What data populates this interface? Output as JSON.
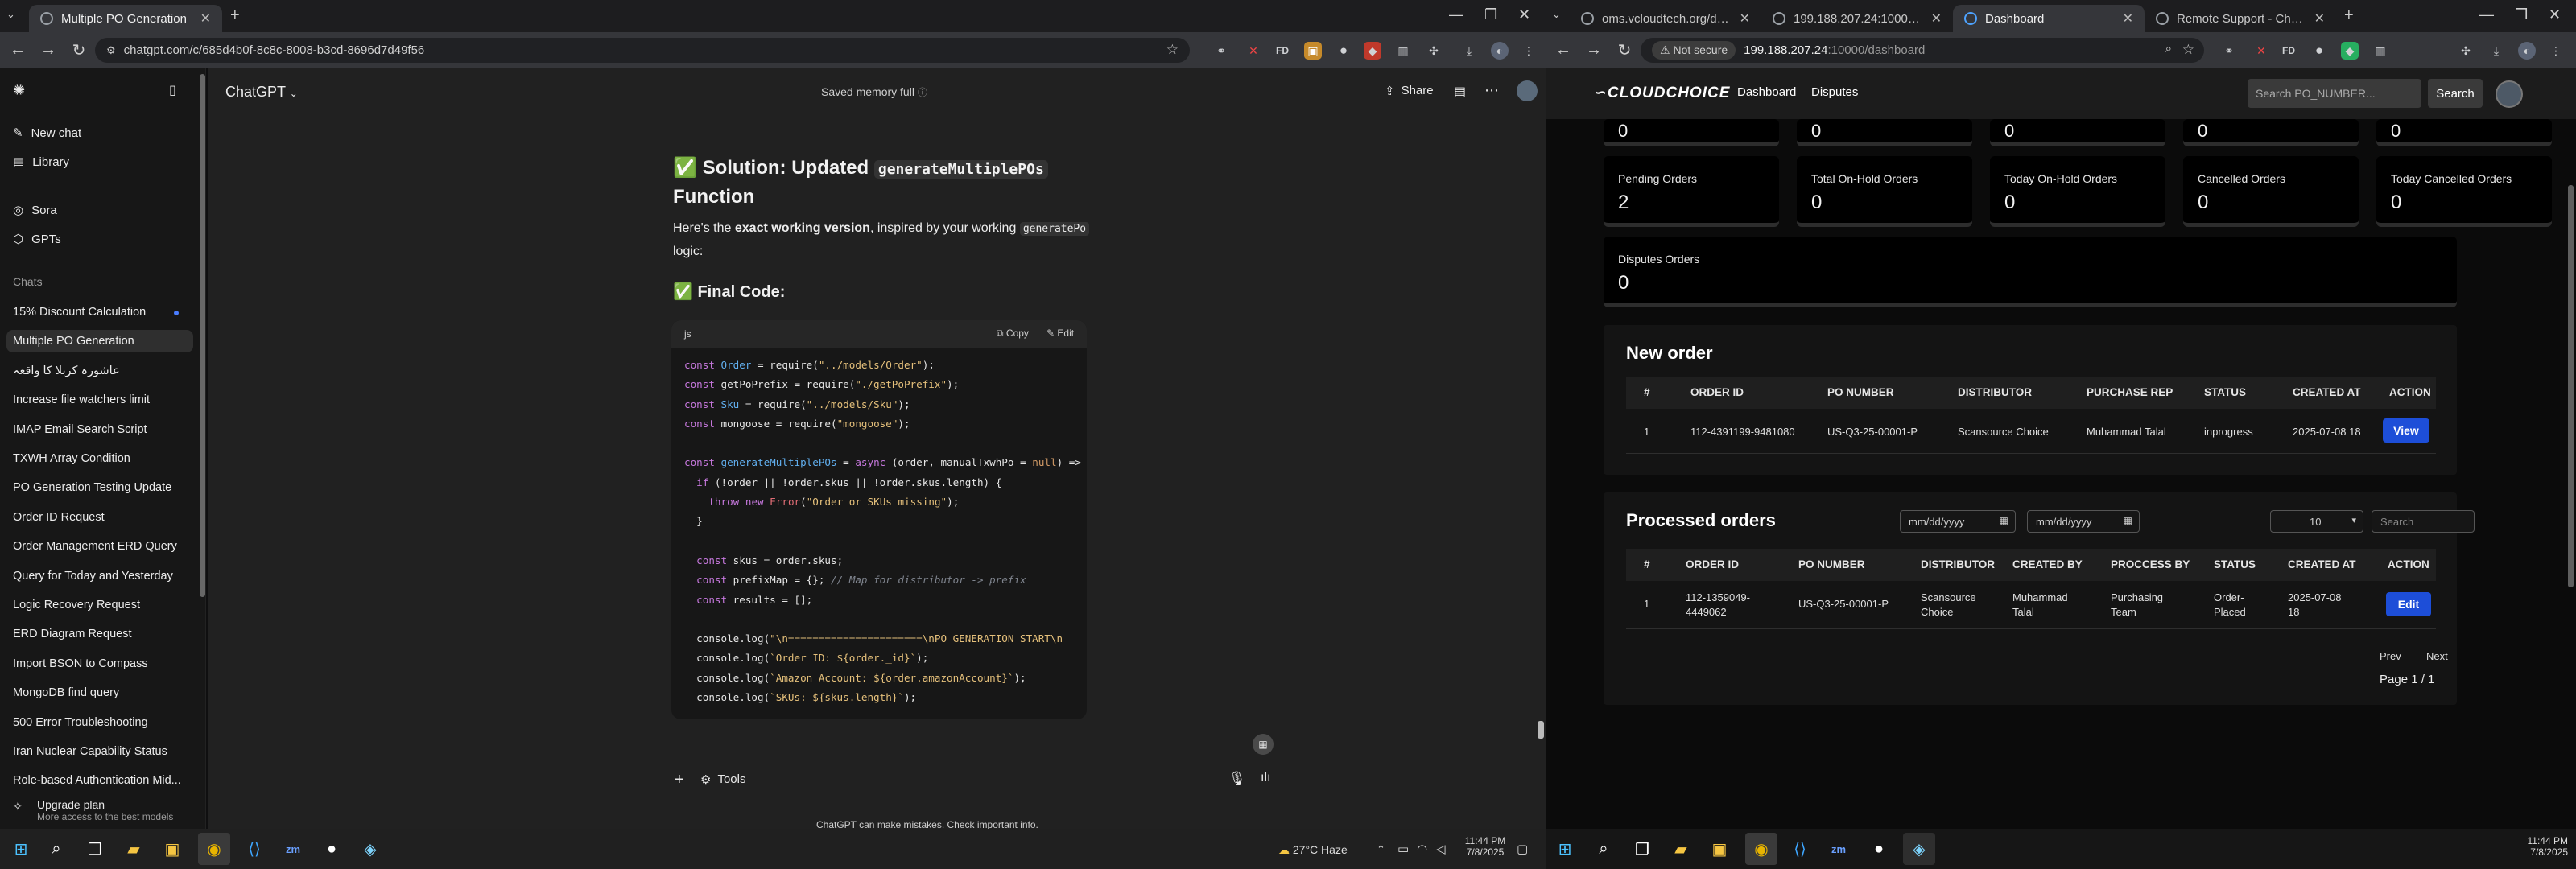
{
  "left_browser": {
    "tabs": [
      {
        "title": "Multiple PO Generation",
        "active": true
      }
    ],
    "url": "chatgpt.com/c/685d4b0f-8c8c-8008-b3cd-8696d7d49f56"
  },
  "chatgpt": {
    "model_label": "ChatGPT",
    "memory_status": "Saved memory full",
    "share_label": "Share",
    "side_items": {
      "new_chat": "New chat",
      "library": "Library",
      "sora": "Sora",
      "gpts": "GPTs"
    },
    "chats_heading": "Chats",
    "chats": [
      "15% Discount Calculation",
      "Multiple PO Generation",
      "عاشورہ کربلا کا واقعہ",
      "Increase file watchers limit",
      "IMAP Email Search Script",
      "TXWH Array Condition",
      "PO Generation Testing Update",
      "Order ID Request",
      "Order Management ERD Query",
      "Query for Today and Yesterday",
      "Logic Recovery Request",
      "ERD Diagram Request",
      "Import BSON to Compass",
      "MongoDB find query",
      "500 Error Troubleshooting",
      "Iran Nuclear Capability Status",
      "Role-based Authentication Mid..."
    ],
    "upgrade_title": "Upgrade plan",
    "upgrade_sub": "More access to the best models",
    "heading_emoji": "✅",
    "heading_prefix": "Solution: Updated",
    "heading_code": "generateMultiplePOs",
    "heading_suffix": "Function",
    "intro_a": "Here's the",
    "intro_bold": "exact working version",
    "intro_b": ", inspired by your working",
    "intro_code": "generatePo",
    "intro_c": "logic:",
    "final_code_heading": "Final Code:",
    "code_lang": "js",
    "copy_label": "Copy",
    "edit_label": "Edit",
    "tools_label": "Tools",
    "disclaimer": "ChatGPT can make mistakes. Check important info."
  },
  "right_browser": {
    "tabs": [
      {
        "title": "oms.vcloudtech.org/dashboard"
      },
      {
        "title": "199.188.207.24:10000/dashboa..."
      },
      {
        "title": "Dashboard",
        "active": true
      },
      {
        "title": "Remote Support - Chrome Rem..."
      }
    ],
    "security_label": "Not secure",
    "url_host": "199.188.207.24",
    "url_rest": ":10000/dashboard"
  },
  "dashboard": {
    "brand": "CLOUDCHOICE",
    "nav": [
      "Dashboard",
      "Disputes"
    ],
    "search_placeholder": "Search PO_NUMBER...",
    "search_button": "Search",
    "top_values": [
      "0",
      "0",
      "0",
      "0",
      "0"
    ],
    "cards": [
      {
        "label": "Pending Orders",
        "value": "2"
      },
      {
        "label": "Total On-Hold Orders",
        "value": "0"
      },
      {
        "label": "Today On-Hold Orders",
        "value": "0"
      },
      {
        "label": "Cancelled Orders",
        "value": "0"
      },
      {
        "label": "Today Cancelled Orders",
        "value": "0"
      },
      {
        "label": "Disputes Orders",
        "value": "0"
      }
    ],
    "new_order": {
      "title": "New order",
      "headers": [
        "#",
        "ORDER ID",
        "PO NUMBER",
        "DISTRIBUTOR",
        "PURCHASE REP",
        "STATUS",
        "CREATED AT",
        "ACTION"
      ],
      "row": [
        "1",
        "112-4391199-9481080",
        "US-Q3-25-00001-P",
        "Scansource Choice",
        "Muhammad Talal",
        "inprogress",
        "2025-07-08 18"
      ],
      "action": "View"
    },
    "processed": {
      "title": "Processed orders",
      "date_placeholder": "mm/dd/yyyy",
      "page_size": "10",
      "search_placeholder": "Search",
      "headers": [
        "#",
        "ORDER ID",
        "PO NUMBER",
        "DISTRIBUTOR",
        "CREATED BY",
        "PROCCESS BY",
        "STATUS",
        "CREATED AT",
        "ACTION"
      ],
      "row": [
        "1",
        "112-1359049-\n4449062",
        "US-Q3-25-00001-P",
        "Scansource\nChoice",
        "Muhammad\nTalal",
        "Purchasing\nTeam",
        "Order-\nPlaced",
        "2025-07-08\n18"
      ],
      "action": "Edit",
      "prev": "Prev",
      "next": "Next",
      "page_info": "Page 1 / 1"
    }
  },
  "taskbar_left": {
    "weather": "27°C  Haze",
    "time": "11:44 PM",
    "date": "7/8/2025"
  },
  "taskbar_right": {
    "time": "11:44 PM",
    "date": "7/8/2025"
  }
}
